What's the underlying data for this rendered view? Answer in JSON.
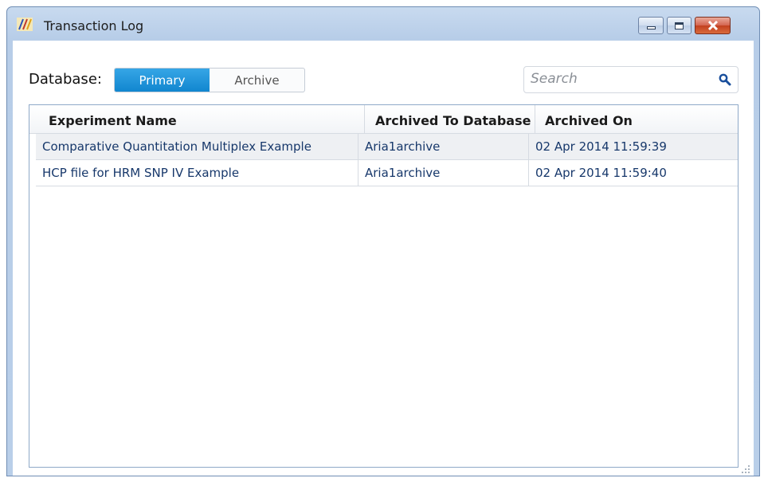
{
  "window": {
    "title": "Transaction Log",
    "controls": [
      "minimize",
      "maximize",
      "close"
    ]
  },
  "toolbar": {
    "database_label": "Database:",
    "segments": [
      {
        "label": "Primary",
        "active": true
      },
      {
        "label": "Archive",
        "active": false
      }
    ],
    "search": {
      "placeholder": "Search",
      "icon": "search-icon"
    }
  },
  "table": {
    "columns": [
      "Experiment Name",
      "Archived To Database",
      "Archived On"
    ],
    "rows": [
      [
        "Comparative Quantitation Multiplex Example",
        "Aria1archive",
        "02 Apr 2014  11:59:39"
      ],
      [
        "HCP file for HRM SNP IV Example",
        "Aria1archive",
        "02 Apr 2014  11:59:40"
      ]
    ]
  },
  "colors": {
    "accent": "#1186cf",
    "close_button": "#c2401f",
    "row_text": "#17386b"
  }
}
